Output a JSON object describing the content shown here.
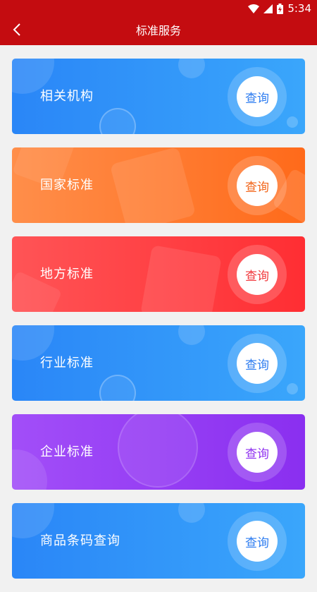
{
  "status_bar": {
    "time": "5:34",
    "battery_icon": "battery-charging-icon",
    "signal_icon": "cell-signal-icon",
    "wifi_icon": "wifi-icon"
  },
  "app_bar": {
    "title": "标准服务",
    "back_icon": "chevron-left-icon"
  },
  "cards": [
    {
      "label": "相关机构",
      "button": "查询",
      "color": "#2f7ff5",
      "text_color": "#2d7cf0"
    },
    {
      "label": "国家标准",
      "button": "查询",
      "color": "#ff6a1a",
      "text_color": "#f26418"
    },
    {
      "label": "地方标准",
      "button": "查询",
      "color": "#ff3a3e",
      "text_color": "#f1383c"
    },
    {
      "label": "行业标准",
      "button": "查询",
      "color": "#2f7ff5",
      "text_color": "#2d7cf0"
    },
    {
      "label": "企业标准",
      "button": "查询",
      "color": "#9a3cf7",
      "text_color": "#8f31f0"
    },
    {
      "label": "商品条码查询",
      "button": "查询",
      "color": "#2f7ff5",
      "text_color": "#2d7cf0"
    }
  ]
}
